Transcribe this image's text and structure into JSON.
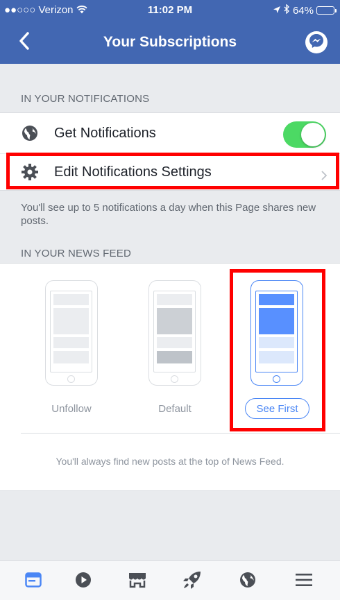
{
  "status": {
    "carrier": "●●○○○ Verizon",
    "time": "11:02 PM",
    "battery": "64%",
    "battery_fraction": 0.64
  },
  "nav": {
    "title": "Your Subscriptions"
  },
  "notifications": {
    "section_title": "IN YOUR NOTIFICATIONS",
    "get_label": "Get Notifications",
    "get_enabled": true,
    "edit_label": "Edit Notifications Settings",
    "note": "You'll see up to 5 notifications a day when this Page shares new posts."
  },
  "news_feed": {
    "section_title": "IN YOUR NEWS FEED",
    "options": [
      {
        "label": "Unfollow",
        "selected": false
      },
      {
        "label": "Default",
        "selected": false
      },
      {
        "label": "See First",
        "selected": true
      }
    ],
    "note": "You'll always find new posts at the top of News Feed."
  },
  "tabbar": {
    "tabs": [
      "news-feed",
      "watch",
      "marketplace",
      "explore",
      "globe",
      "menu"
    ],
    "active": "news-feed"
  },
  "colors": {
    "brand": "#4267b2",
    "accent": "#4a86f5",
    "toggle_on": "#4cd964",
    "highlight": "#ff0000"
  }
}
